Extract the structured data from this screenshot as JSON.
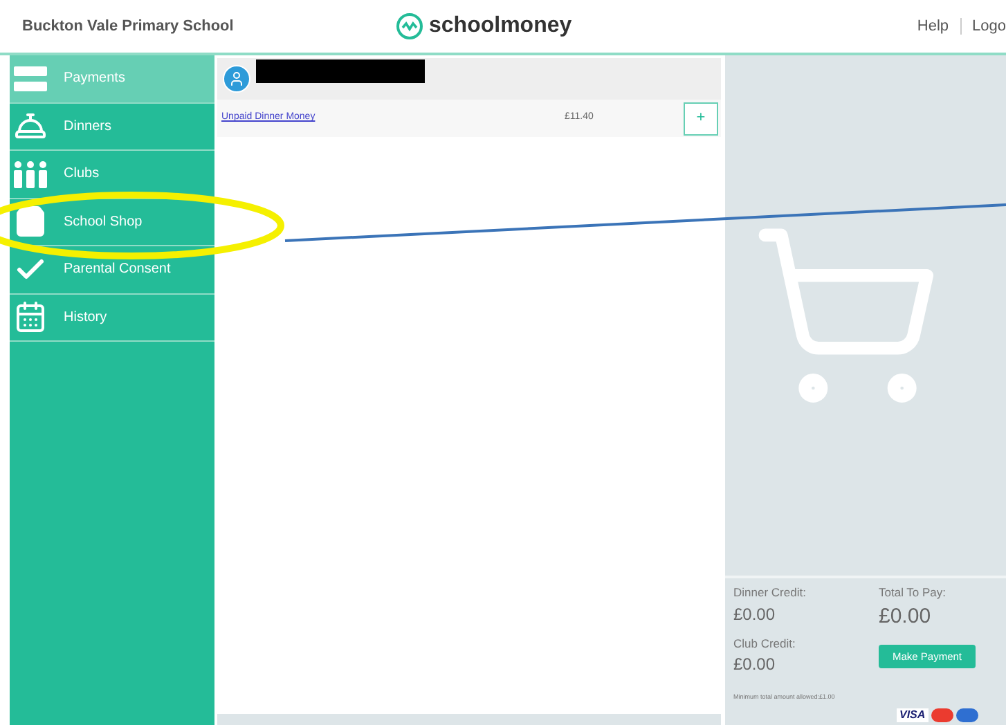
{
  "header": {
    "school": "Buckton Vale Primary School",
    "logo_text": "schoolmoney",
    "links": [
      "Help",
      "Logo"
    ]
  },
  "sidebar": {
    "items": [
      {
        "label": "Payments",
        "selected": true
      },
      {
        "label": "Dinners",
        "selected": false
      },
      {
        "label": "Clubs",
        "selected": false
      },
      {
        "label": "School Shop",
        "selected": false
      },
      {
        "label": "Parental Consent",
        "selected": false
      },
      {
        "label": "History",
        "selected": false
      }
    ]
  },
  "payments": [
    {
      "name": "Unpaid Dinner Money",
      "amount": "£11.40",
      "button": "+"
    }
  ],
  "basket": {
    "dinner_credit_label": "Dinner Credit:",
    "dinner_credit": "£0.00",
    "club_credit_label": "Club Credit:",
    "club_credit": "£0.00",
    "total_label": "Total To Pay:",
    "total": "£0.00",
    "pay_button": "Make Payment",
    "minimum_note": "Minimum total amount allowed:£1.00",
    "card_brand": "VISA"
  }
}
